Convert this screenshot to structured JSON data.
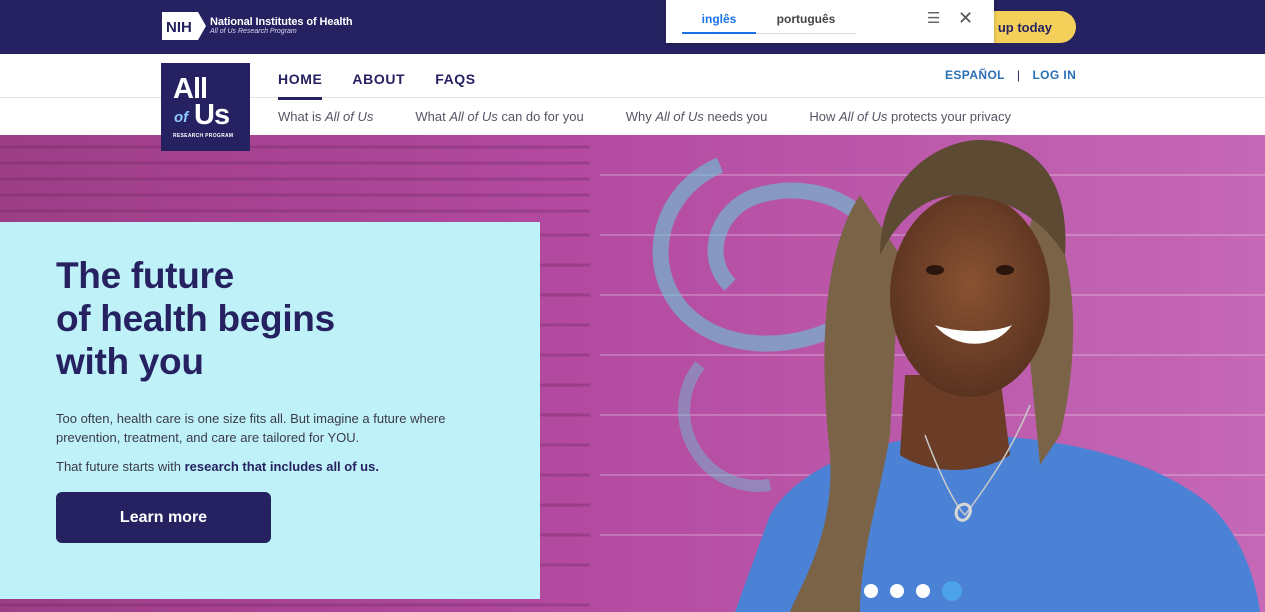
{
  "nih": {
    "logo_text": "NIH",
    "title": "National Institutes of Health",
    "subtitle": "All of Us Research Program"
  },
  "signup": {
    "label": "up today"
  },
  "translate": {
    "tabs": [
      "inglês",
      "português"
    ],
    "menu_glyph": "☰",
    "close_glyph": "✕"
  },
  "brand": {
    "all": "All",
    "of": "of",
    "us": "Us",
    "program": "RESEARCH PROGRAM"
  },
  "main_nav": [
    {
      "label": "HOME",
      "active": true
    },
    {
      "label": "ABOUT",
      "active": false
    },
    {
      "label": "FAQS",
      "active": false
    }
  ],
  "util_nav": {
    "espanol": "ESPAÑOL",
    "separator": "|",
    "login": "LOG IN"
  },
  "sub_nav": [
    {
      "pre": "What is ",
      "em": "All of Us",
      "post": ""
    },
    {
      "pre": "What ",
      "em": "All of Us",
      "post": " can do for you"
    },
    {
      "pre": "Why ",
      "em": "All of Us",
      "post": " needs you"
    },
    {
      "pre": "How ",
      "em": "All of Us",
      "post": " protects your privacy"
    }
  ],
  "hero": {
    "title_line1": "The future",
    "title_line2": "of health begins",
    "title_line3": "with you",
    "para1": "Too often, health care is one size fits all. But imagine a future where prevention, treatment, and care are tailored for YOU.",
    "para2_pre": "That future starts with ",
    "para2_bold": "research that includes all of us.",
    "cta": "Learn more"
  },
  "carousel": {
    "slides": 4,
    "active_index": 3
  },
  "colors": {
    "navy": "#262262",
    "cyan_card": "#bff2f8",
    "accent_blue": "#2a6fb5",
    "signup_yellow": "#f4d05a",
    "photo_magenta": "#b84fa6"
  }
}
